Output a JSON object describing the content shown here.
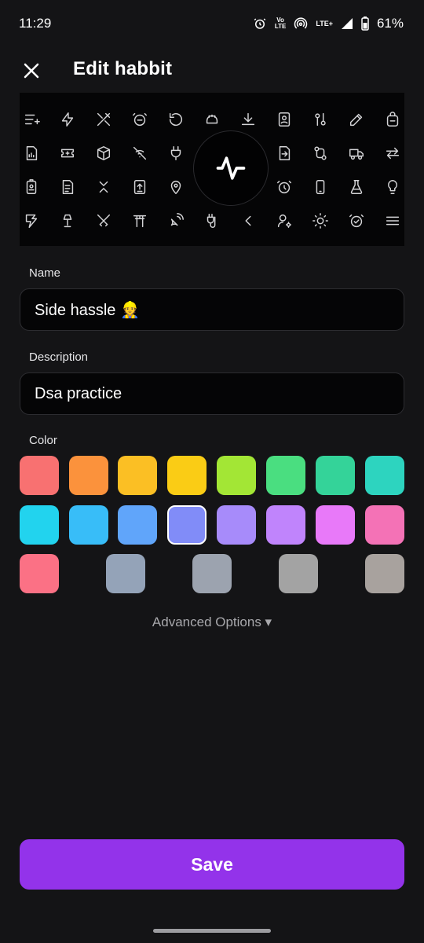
{
  "status_bar": {
    "time": "11:29",
    "volte_top": "Vo",
    "volte_bottom": "LTE",
    "network": "LTE+",
    "battery": "61%"
  },
  "header": {
    "title": "Edit habbit",
    "close_icon": "close-icon"
  },
  "icon_picker": {
    "selected_icon": "activity-icon",
    "icons": [
      [
        "list-add-icon",
        "bolt-icon",
        "tools-cross-icon",
        "alarm-minus-icon",
        "refresh-icon",
        "hand-icon",
        "download-icon",
        "contact-book-icon",
        "adjustments-icon",
        "pencil-icon",
        "backpack-icon"
      ],
      [
        "report-icon",
        "ticket-icon",
        "package-icon",
        "no-signal-icon",
        "plug-icon",
        "",
        "printer-icon",
        "file-export-icon",
        "route-icon",
        "truck-icon",
        "arrows-exchange-icon"
      ],
      [
        "id-badge-icon",
        "file-text-icon",
        "selector-icon",
        "upload-book-icon",
        "map-pin-icon",
        "",
        "align-icon",
        "alarm-icon",
        "device-mobile-icon",
        "flask-icon",
        "bulb-icon"
      ],
      [
        "transform-icon",
        "lamp-icon",
        "swords-icon",
        "torii-icon",
        "satellite-icon",
        "plug-cable-icon",
        "chevron-left-icon",
        "user-settings-icon",
        "sun-icon",
        "alarm-check-icon",
        "menu-icon"
      ]
    ]
  },
  "name_field": {
    "label": "Name",
    "value": "Side hassle 👷"
  },
  "description_field": {
    "label": "Description",
    "value": "Dsa practice"
  },
  "color_picker": {
    "label": "Color",
    "selected": "#818cf8",
    "rows": [
      [
        "#f87171",
        "#fb923c",
        "#fbbf24",
        "#facc15",
        "#a3e635",
        "#4ade80",
        "#34d399",
        "#2dd4bf"
      ],
      [
        "#22d3ee",
        "#38bdf8",
        "#60a5fa",
        "#818cf8",
        "#a78bfa",
        "#c084fc",
        "#e879f9",
        "#f472b6"
      ],
      [
        "#fb7185",
        "#94a3b8",
        "#9ca3af",
        "#a3a3a3",
        "#a8a29e"
      ]
    ]
  },
  "advanced_options": {
    "label": "Advanced Options ▾"
  },
  "save_button": {
    "label": "Save",
    "color": "#9333ea"
  }
}
